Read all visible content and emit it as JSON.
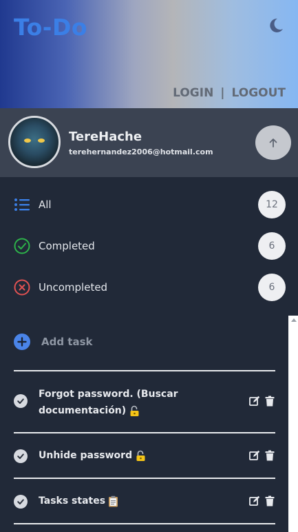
{
  "header": {
    "title": "To-Do",
    "login_label": "LOGIN",
    "separator": "|",
    "logout_label": "LOGOUT"
  },
  "profile": {
    "name": "TereHache",
    "email": "terehernandez2006@hotmail.com"
  },
  "filters": [
    {
      "label": "All",
      "count": "12"
    },
    {
      "label": "Completed",
      "count": "6"
    },
    {
      "label": "Uncompleted",
      "count": "6"
    }
  ],
  "add_task": {
    "label": "Add task"
  },
  "tasks": [
    {
      "line1": "Forgot password. (Buscar",
      "line2": "documentación)",
      "emoji": "lock-key-icon"
    },
    {
      "line1": "Unhide password",
      "emoji": "lock-key-icon"
    },
    {
      "line1": "Tasks states",
      "emoji": "clipboard-icon"
    }
  ],
  "colors": {
    "accent": "#3b7fe6",
    "completed": "#2db34a",
    "uncompleted": "#e05252",
    "panel": "#212938",
    "profile": "#3b4352"
  }
}
